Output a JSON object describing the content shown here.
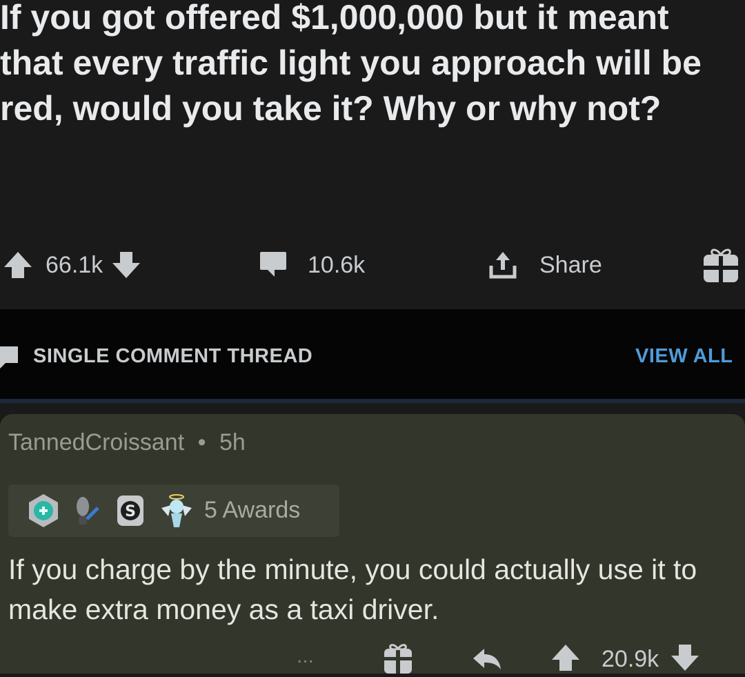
{
  "post": {
    "title": "If you got offered $1,000,000 but it meant that every traffic light you approach will be red, would you take it? Why or why not?",
    "upvotes": "66.1k",
    "comments": "10.6k",
    "share_label": "Share"
  },
  "thread": {
    "label": "SINGLE COMMENT THREAD",
    "view_all": "VIEW ALL"
  },
  "comment": {
    "author": "TannedCroissant",
    "separator": "•",
    "age": "5h",
    "awards_label": "5 Awards",
    "body": "If you charge by the minute, you could actually use it to make extra money as a taxi driver.",
    "more": "...",
    "score": "20.9k"
  },
  "colors": {
    "background": "#1a1a1b",
    "comment_bg": "#33362a",
    "accent_blue": "#4f9bd9"
  }
}
